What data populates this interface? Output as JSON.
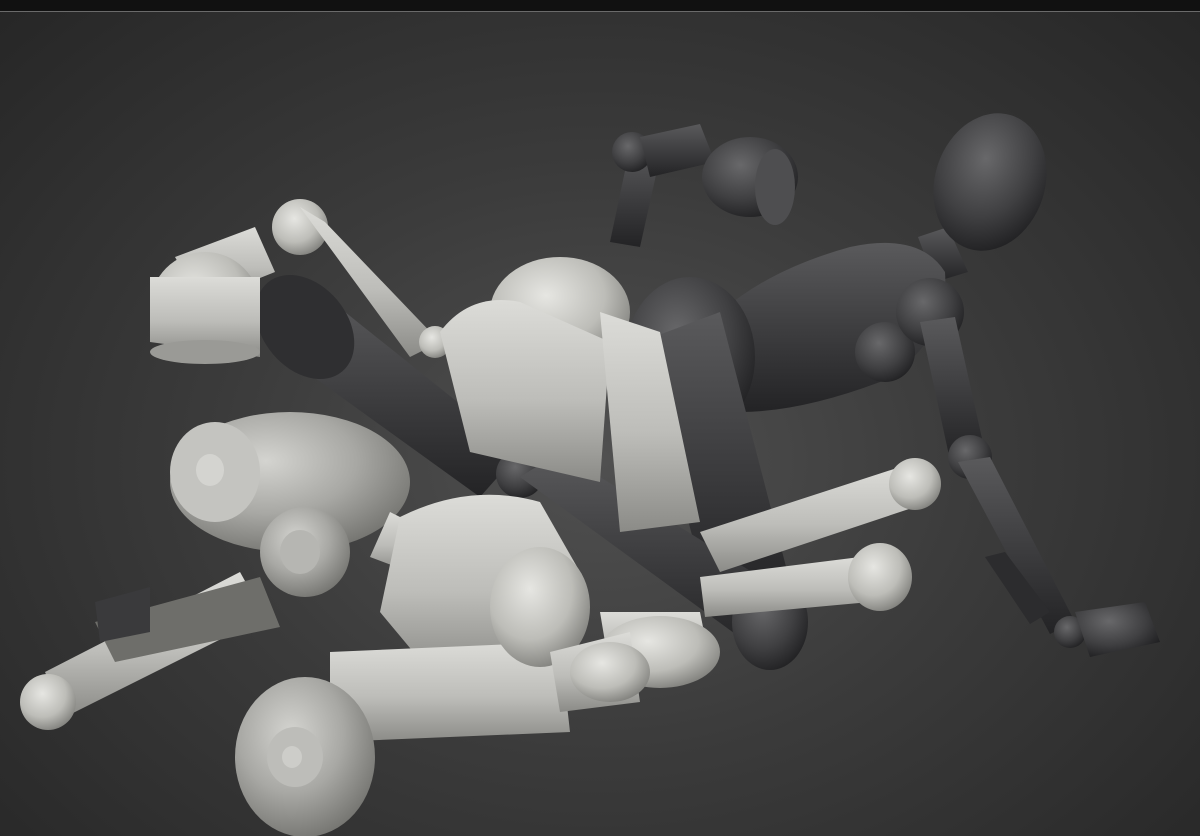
{
  "viewport": {
    "subject": "posed-figure-mannequins",
    "figures": [
      {
        "name": "light-mannequin-front",
        "tone": "light"
      },
      {
        "name": "light-mannequin-back",
        "tone": "light"
      },
      {
        "name": "dark-mannequin",
        "tone": "dark"
      }
    ]
  },
  "colors": {
    "background_center": "#505050",
    "background_edge": "#262626",
    "light_figure": "#c8c8c4",
    "light_figure_shade": "#8a8a86",
    "dark_figure": "#4a4a4c",
    "dark_figure_shade": "#2a2a2c",
    "top_border": "#111111",
    "top_border_line": "#6a6a6a"
  }
}
